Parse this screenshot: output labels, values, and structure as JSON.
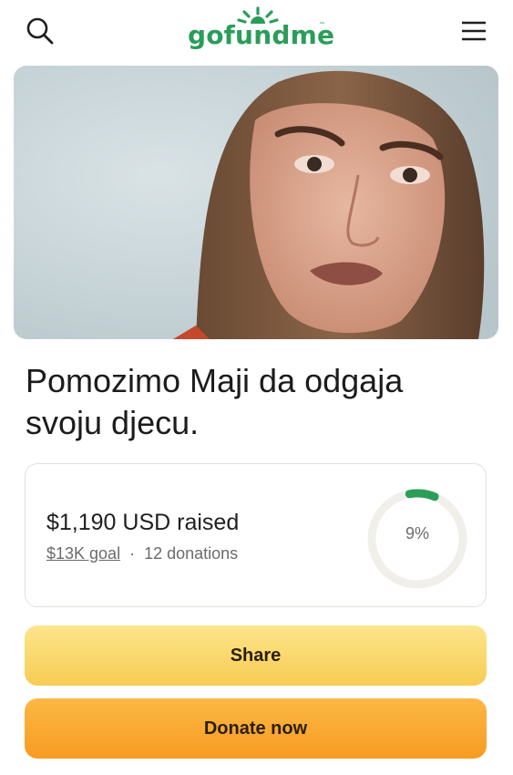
{
  "header": {
    "logo_text": "gofundme",
    "logo_tm": "™",
    "search_icon": "search-icon",
    "menu_icon": "hamburger-menu-icon"
  },
  "campaign": {
    "title": "Pomozimo Maji da odgaja svoju djecu."
  },
  "progress": {
    "raised": "$1,190 USD raised",
    "goal": "$13K goal",
    "separator": "·",
    "donations": "12 donations",
    "percent_label": "9%",
    "percent_value": 0.09
  },
  "actions": {
    "share_label": "Share",
    "donate_label": "Donate now"
  },
  "colors": {
    "brand_green": "#2a9d59",
    "share_yellow": "#f7cc53",
    "donate_orange": "#f79b22",
    "ring_track": "#f1efea"
  }
}
